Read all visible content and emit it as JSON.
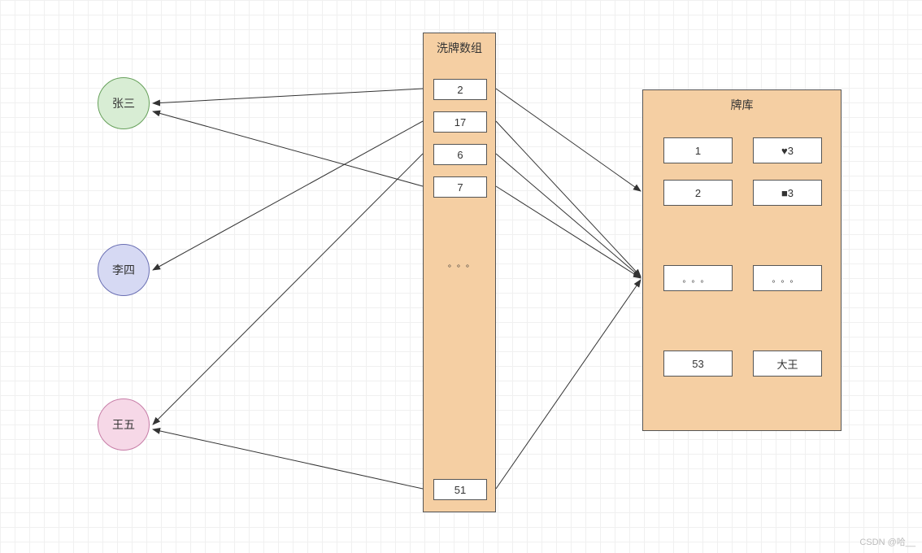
{
  "players": {
    "p1": "张三",
    "p2": "李四",
    "p3": "王五"
  },
  "shuffle": {
    "title": "洗牌数组",
    "items": [
      "2",
      "17",
      "6",
      "7"
    ],
    "ellipsis": "。。。",
    "last": "51"
  },
  "deck": {
    "title": "牌库",
    "rows": [
      {
        "left": "1",
        "right": "♥3"
      },
      {
        "left": "2",
        "right": "■3"
      }
    ],
    "ellipsisLeft": "。。。",
    "ellipsisRight": "。。。",
    "lastLeft": "53",
    "lastRight": "大王"
  },
  "watermark": "CSDN @哈__"
}
